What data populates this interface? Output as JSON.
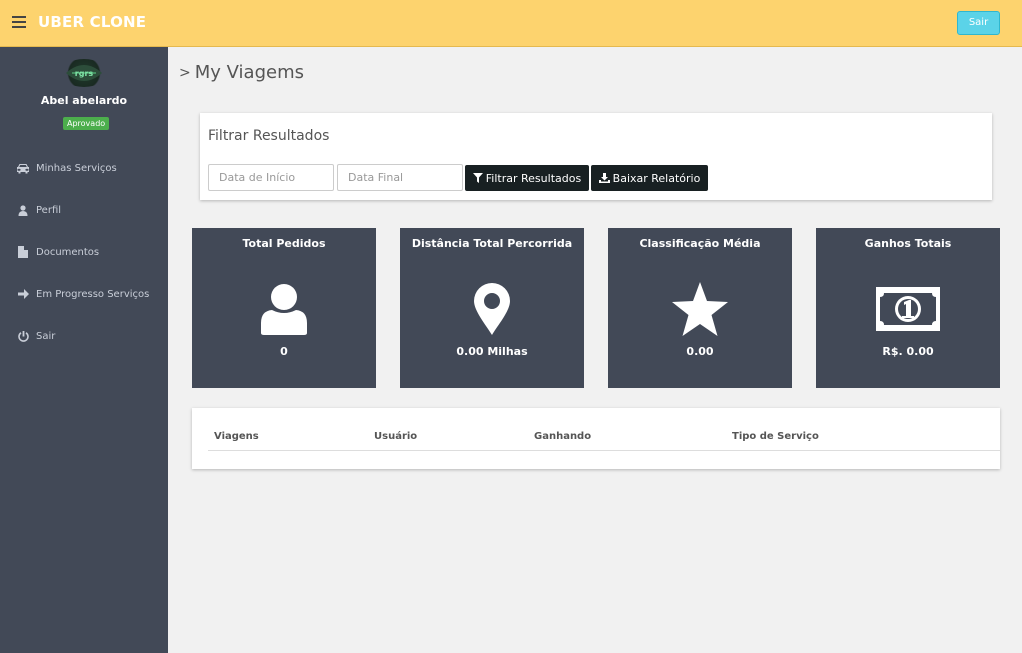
{
  "header": {
    "brand": "UBER CLONE",
    "logout_label": "Sair",
    "bar_color": "#fdd36e"
  },
  "sidebar": {
    "user_name": "Abel abelardo",
    "status_badge": "Aprovado",
    "items": [
      {
        "label": "Minhas Serviços",
        "icon": "car-icon"
      },
      {
        "label": "Perfil",
        "icon": "user-icon"
      },
      {
        "label": "Documentos",
        "icon": "file-icon"
      },
      {
        "label": "Em Progresso Serviços",
        "icon": "arrow-right-icon"
      },
      {
        "label": "Sair",
        "icon": "power-icon"
      }
    ]
  },
  "main": {
    "page_title": "My Viagems",
    "filter": {
      "title": "Filtrar Resultados",
      "start_placeholder": "Data de Início",
      "end_placeholder": "Data Final",
      "filter_button": "Filtrar Resultados",
      "download_button": "Baixar Relatório"
    },
    "stats": [
      {
        "title": "Total Pedidos",
        "value": "0",
        "icon": "user-icon"
      },
      {
        "title": "Distância Total Percorrida",
        "value": "0.00 Milhas",
        "icon": "map-marker-icon"
      },
      {
        "title": "Classificação Média",
        "value": "0.00",
        "icon": "star-icon"
      },
      {
        "title": "Ganhos Totais",
        "value": "R$. 0.00",
        "icon": "money-icon"
      }
    ],
    "table": {
      "columns": [
        "Viagens",
        "Usuário",
        "Ganhando",
        "Tipo de Serviço"
      ]
    }
  }
}
